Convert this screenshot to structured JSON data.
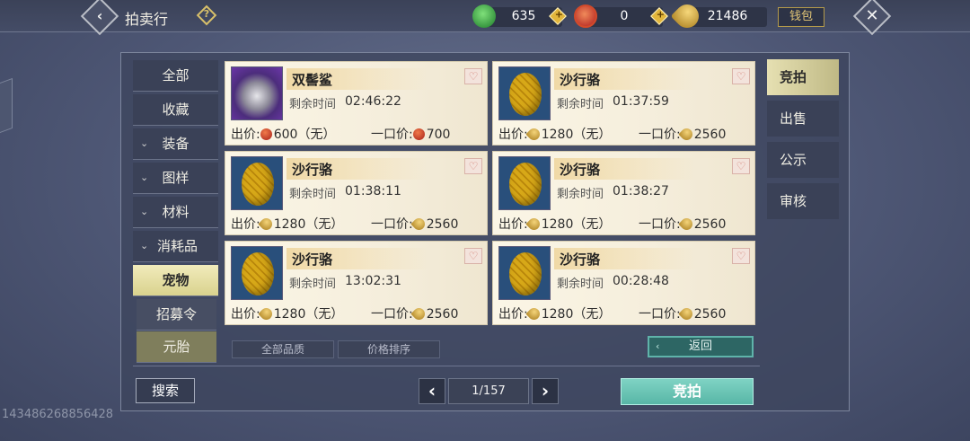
{
  "header": {
    "back_glyph": "‹",
    "title": "拍卖行",
    "help_glyph": "?",
    "currencies": [
      {
        "name": "jade-icon",
        "value": "635"
      },
      {
        "name": "red-coin-icon",
        "value": "0"
      },
      {
        "name": "gold-ingot-icon",
        "value": "21486"
      }
    ],
    "plus_glyph": "+",
    "wallet_label": "钱包",
    "close_glyph": "✕"
  },
  "left_menu": {
    "items": [
      {
        "label": "全部",
        "expandable": false
      },
      {
        "label": "收藏",
        "expandable": false
      },
      {
        "label": "装备",
        "expandable": true
      },
      {
        "label": "图样",
        "expandable": true
      },
      {
        "label": "材料",
        "expandable": true
      },
      {
        "label": "消耗品",
        "expandable": true
      }
    ],
    "sub_items": [
      {
        "label": "宠物",
        "active": true
      },
      {
        "label": "招募令",
        "active": false
      },
      {
        "label": "元胎",
        "active": false
      }
    ],
    "chevron_glyph": "⌄"
  },
  "listings": {
    "remain_label": "剩余时间",
    "price_label": "出价:",
    "buyout_label": "一口价:",
    "fav_glyph": "♡",
    "items": [
      {
        "name": "双髻鲨",
        "time": "02:46:22",
        "price": "600（无）",
        "buyout": "700",
        "currency": "red",
        "image": "shark"
      },
      {
        "name": "沙行骆",
        "time": "01:37:59",
        "price": "1280（无）",
        "buyout": "2560",
        "currency": "gold",
        "image": "egg"
      },
      {
        "name": "沙行骆",
        "time": "01:38:11",
        "price": "1280（无）",
        "buyout": "2560",
        "currency": "gold",
        "image": "egg"
      },
      {
        "name": "沙行骆",
        "time": "01:38:27",
        "price": "1280（无）",
        "buyout": "2560",
        "currency": "gold",
        "image": "egg"
      },
      {
        "name": "沙行骆",
        "time": "13:02:31",
        "price": "1280（无）",
        "buyout": "2560",
        "currency": "gold",
        "image": "egg"
      },
      {
        "name": "沙行骆",
        "time": "00:28:48",
        "price": "1280（无）",
        "buyout": "2560",
        "currency": "gold",
        "image": "egg"
      }
    ]
  },
  "filters": {
    "quality_label": "全部品质",
    "sort_label": "价格排序",
    "return_label": "返回",
    "return_glyph": "‹"
  },
  "right_tabs": [
    {
      "label": "竞拍",
      "active": true
    },
    {
      "label": "出售",
      "active": false
    },
    {
      "label": "公示",
      "active": false
    },
    {
      "label": "审核",
      "active": false
    }
  ],
  "bottom": {
    "search_label": "搜索",
    "prev_glyph": "‹",
    "next_glyph": "›",
    "page": "1/157",
    "bid_label": "竞拍",
    "user_id": "143486268856428"
  }
}
